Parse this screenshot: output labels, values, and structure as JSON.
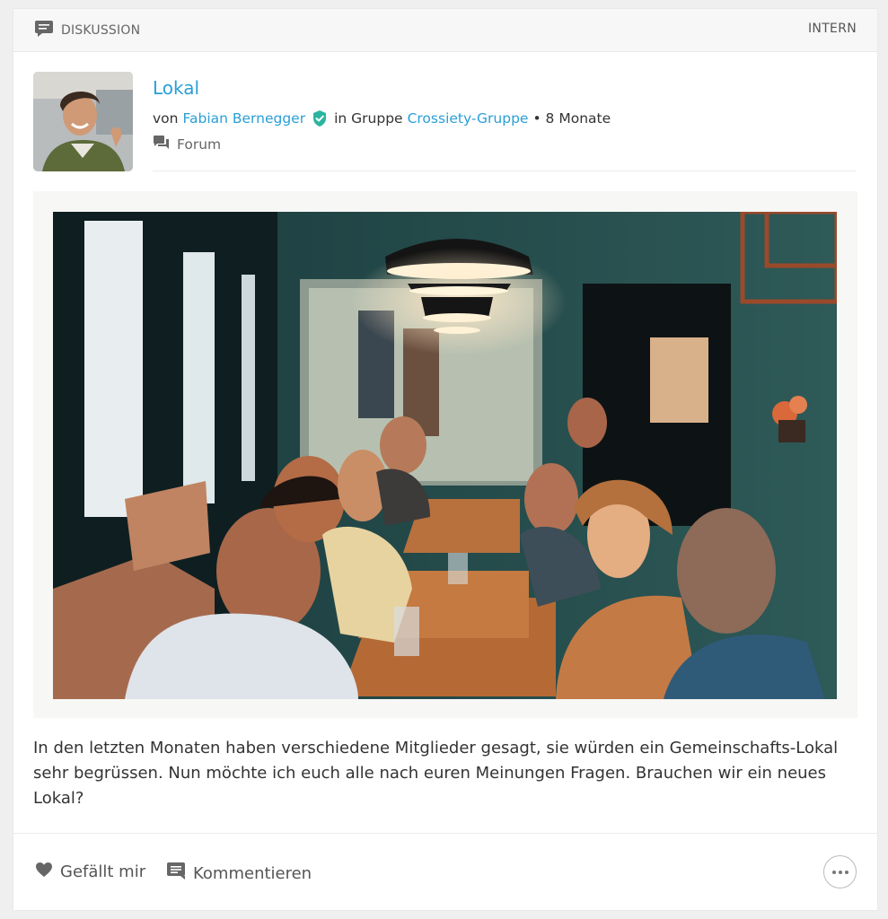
{
  "header": {
    "type_label": "DISKUSSION",
    "visibility_label": "INTERN"
  },
  "post": {
    "title": "Lokal",
    "by_prefix": "von",
    "author": "Fabian Bernegger",
    "group_prefix": "in Gruppe",
    "group": "Crossiety-Gruppe",
    "time": "• 8 Monate",
    "category": "Forum",
    "body": "In den letzten Monaten haben verschiedene Mitglieder gesagt, sie würden ein Gemeinschafts-Lokal sehr begrüssen. Nun möchte ich euch alle nach euren Meinungen Fragen. Brauchen wir ein neues Lokal?"
  },
  "footer": {
    "like_label": "Gefällt mir",
    "comment_label": "Kommentieren"
  },
  "colors": {
    "link": "#2a9fd6",
    "verified": "#2bb5a0"
  },
  "icons": [
    "discussion-icon",
    "verified-badge-icon",
    "forum-icon",
    "heart-icon",
    "comment-icon",
    "more-icon"
  ]
}
